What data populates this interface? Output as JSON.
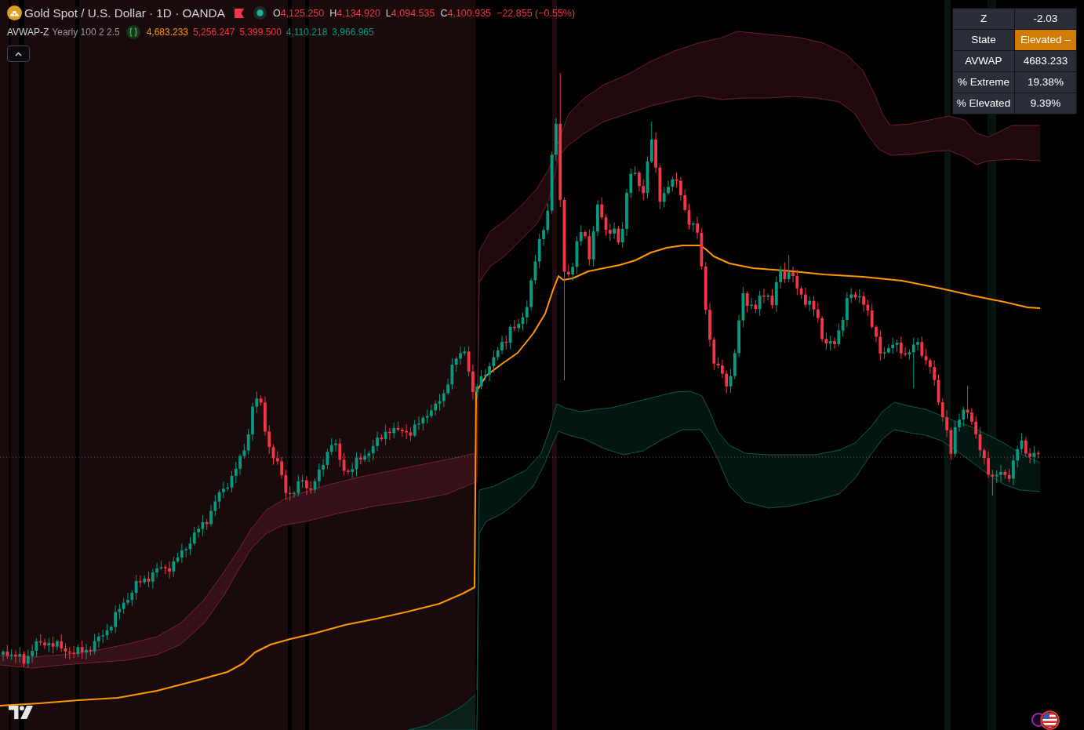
{
  "symbol": {
    "title": "Gold Spot / U.S. Dollar · 1D · OANDA",
    "market_open": true,
    "falling": true,
    "ohlc": [
      {
        "label": "O",
        "value": "4,125.250"
      },
      {
        "label": "H",
        "value": "4,134.920"
      },
      {
        "label": "L",
        "value": "4,094.535"
      },
      {
        "label": "C",
        "value": "4,100.935"
      }
    ],
    "change": "−22.855 (−0.55%)"
  },
  "indicator": {
    "name": "AVWAP-Z",
    "params": "Yearly 100 2 2.5",
    "values": [
      {
        "value": "4,683.233",
        "color": "#ff9800"
      },
      {
        "value": "5,256.247",
        "color": "#f23645"
      },
      {
        "value": "5,399.500",
        "color": "#f23645"
      },
      {
        "value": "4,110.218",
        "color": "#089981"
      },
      {
        "value": "3,966.965",
        "color": "#089981"
      }
    ]
  },
  "stats_table": {
    "rows": [
      {
        "label": "Z",
        "value": "-2.03",
        "highlighted": false
      },
      {
        "label": "State",
        "value": "Elevated –",
        "highlighted": true
      },
      {
        "label": "AVWAP",
        "value": "4683.233",
        "highlighted": false
      },
      {
        "label": "% Extreme",
        "value": "19.38%",
        "highlighted": false
      },
      {
        "label": "% Elevated",
        "value": "9.39%",
        "highlighted": false
      }
    ]
  }
}
